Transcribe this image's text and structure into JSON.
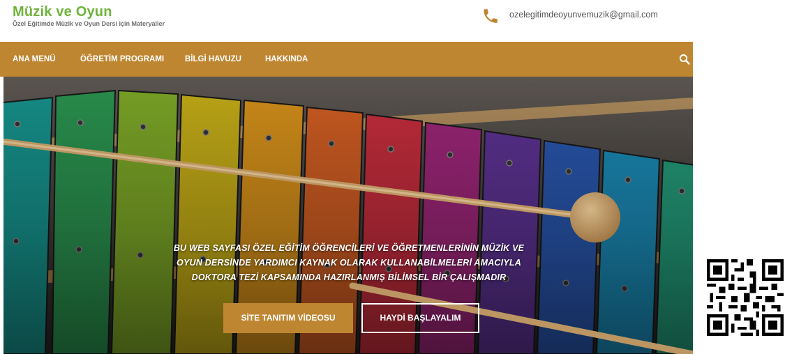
{
  "site": {
    "title": "Müzik ve Oyun",
    "subtitle": "Özel Eğitimde Müzik ve Oyun Dersi için Materyaller",
    "email": "ozelegitimdeoyunvemuzik@gmail.com"
  },
  "nav": {
    "items": [
      {
        "label": "ANA MENÜ"
      },
      {
        "label": "ÖĞRETİM PROGRAMI"
      },
      {
        "label": "BİLGİ HAVUZU"
      },
      {
        "label": "HAKKINDA"
      }
    ]
  },
  "hero": {
    "lines": [
      "BU WEB SAYFASI ÖZEL EĞİTİM ÖĞRENCİLERİ VE ÖĞRETMENLERİNİN MÜZİK VE",
      "OYUN DERSİNDE YARDIMCI KAYNAK OLARAK KULLANABİLMELERİ AMACIYLA",
      "DOKTORA TEZİ KAPSAMINDA HAZIRLANMIŞ BİLİMSEL BİR ÇALIŞMADIR"
    ],
    "primary_button": "SİTE TANITIM VİDEOSU",
    "secondary_button": "HAYDİ BAŞLAYALIM"
  },
  "colors": {
    "brand_green": "#6fb33b",
    "accent_brown": "#bf8632",
    "text_gray": "#6e6e6e"
  },
  "icons": {
    "phone": "phone-icon",
    "search": "search-icon",
    "qr": "qr-code"
  }
}
